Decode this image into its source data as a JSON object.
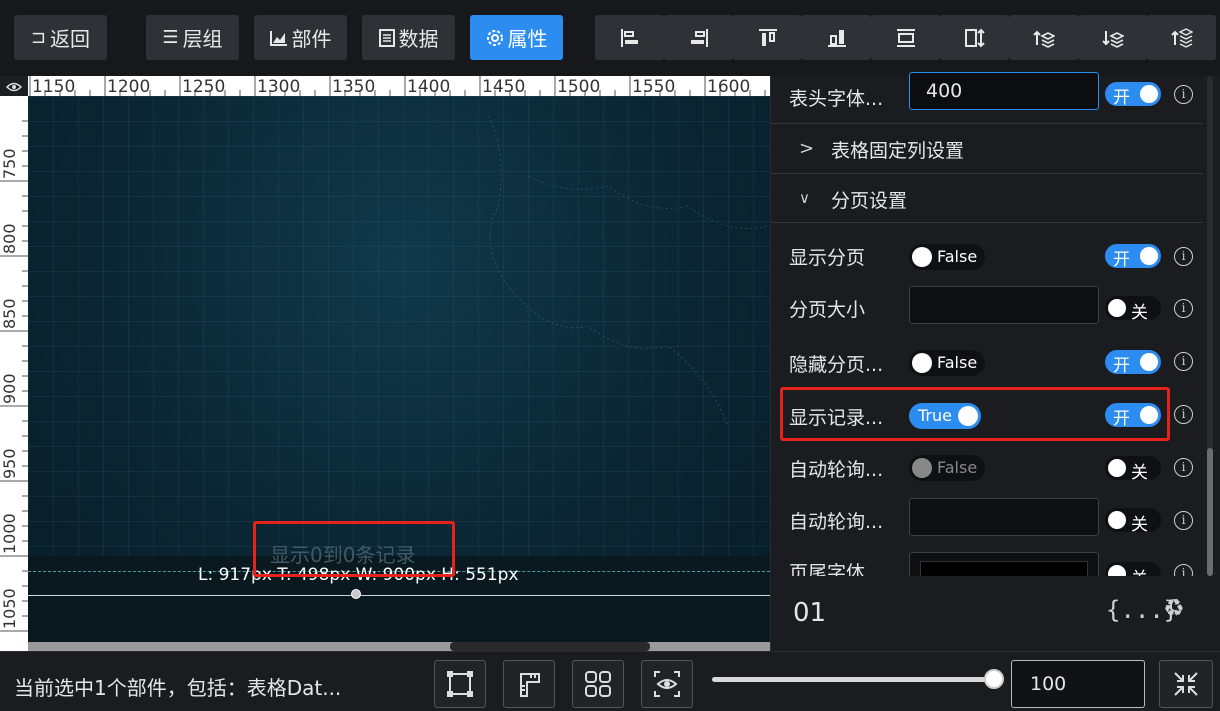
{
  "toolbar": {
    "back_label": "返回",
    "layers_label": "层组",
    "components_label": "部件",
    "data_label": "数据",
    "props_label": "属性",
    "align_icons": [
      "align-left-icon",
      "align-right-icon",
      "align-top-icon",
      "align-bottom-icon",
      "distribute-horizontal-icon",
      "distribute-vertical-icon",
      "bring-forward-icon",
      "send-backward-icon",
      "bring-to-front-icon"
    ],
    "active_color": "#2d8cf0"
  },
  "ruler": {
    "top_labels": [
      "1150",
      "1200",
      "1250",
      "1300",
      "1350",
      "1400",
      "1450",
      "1500",
      "1550",
      "1600"
    ],
    "left_labels": [
      "750",
      "800",
      "850",
      "900",
      "950",
      "1000",
      "1050"
    ]
  },
  "canvas": {
    "record_text": "显示0到0条记录",
    "selection_info": "L: 917px T: 498px W: 900px H: 551px"
  },
  "panel": {
    "header_font_label": "表头字体...",
    "header_font_value": "400",
    "fixed_col_section": "表格固定列设置",
    "pagination_section": "分页设置",
    "rows": [
      {
        "label": "显示分页",
        "value": "False"
      },
      {
        "label": "分页大小",
        "value": ""
      },
      {
        "label": "隐藏分页...",
        "value": "False"
      },
      {
        "label": "显示记录...",
        "value": "True"
      },
      {
        "label": "自动轮询...",
        "value": "False"
      },
      {
        "label": "自动轮询...",
        "value": ""
      },
      {
        "label": "页尾字体",
        "value": ""
      }
    ],
    "switch_on": "开",
    "switch_off": "关",
    "footer_num": "01",
    "footer_code": "{...}",
    "highlight_color": "#e5231b"
  },
  "statusbar": {
    "selection_text": "当前选中1个部件，包括：表格Dat...",
    "zoom_value": "100",
    "zoom_percent": 100
  }
}
